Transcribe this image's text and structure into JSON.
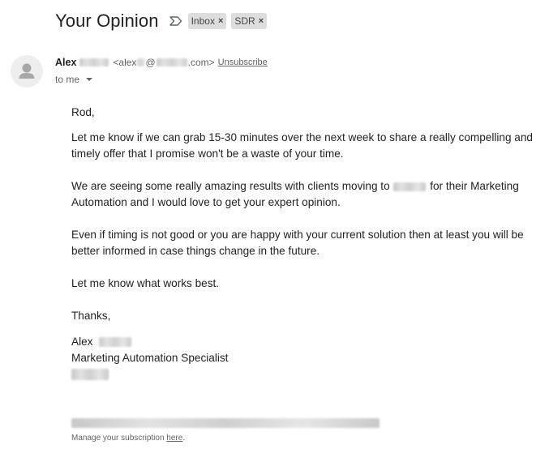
{
  "email": {
    "subject": "Your Opinion",
    "labels": [
      {
        "name": "Inbox",
        "remove_glyph": "×"
      },
      {
        "name": "SDR",
        "remove_glyph": "×"
      }
    ],
    "importance_icon": "label-important-outline-icon",
    "avatar_icon": "person-silhouette-icon",
    "sender": {
      "first_name": "Alex",
      "email_prefix": "<alex",
      "email_at": "@",
      "email_domain_suffix": ".com>",
      "unsubscribe_label": "Unsubscribe"
    },
    "recipient_label": "to me",
    "body": {
      "greeting": "Rod,",
      "paragraph_1": "Let me know if we can grab 15-30 minutes over the next week to share a really compelling and timely offer that I promise won't be a waste of your time.",
      "paragraph_2_before": "We are seeing some really amazing results with clients moving to",
      "paragraph_2_after": "for their Marketing Automation and I would love to get your expert opinion.",
      "paragraph_3": "Even if timing is not good or you are happy with your current solution then at least you will be better informed in case things change in the future.",
      "paragraph_4": "Let me know what works best.",
      "closing": "Thanks,",
      "signature_name": "Alex",
      "signature_title": "Marketing Automation Specialist"
    },
    "footer": {
      "text": "Manage your subscription ",
      "link": "here",
      "period": "."
    }
  },
  "colors": {
    "chip_background": "#dddddd",
    "text_primary": "#202124",
    "text_secondary": "#5f6368",
    "avatar_background": "#eeeeee"
  }
}
